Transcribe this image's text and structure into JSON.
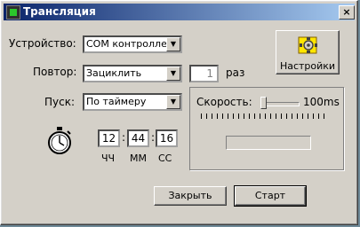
{
  "window": {
    "title": "Трансляция",
    "close": "×"
  },
  "device": {
    "label": "Устройство:",
    "value": "COM контроллер"
  },
  "repeat": {
    "label": "Повтор:",
    "value": "Зациклить",
    "count": "1",
    "unit": "раз"
  },
  "start": {
    "label": "Пуск:",
    "value": "По таймеру"
  },
  "timer": {
    "hh": "12",
    "mm": "44",
    "ss": "16",
    "hh_label": "ЧЧ",
    "mm_label": "ММ",
    "ss_label": "СС",
    "sep": ":"
  },
  "settings": {
    "label": "Настройки"
  },
  "speed": {
    "label": "Скорость:",
    "value_text": "100ms",
    "level": 0.02
  },
  "progress": {
    "level": 0
  },
  "buttons": {
    "close": "Закрыть",
    "start": "Старт"
  },
  "colors": {
    "title_start": "#0a246a",
    "title_end": "#a6caf0",
    "face": "#d4d0c8"
  }
}
